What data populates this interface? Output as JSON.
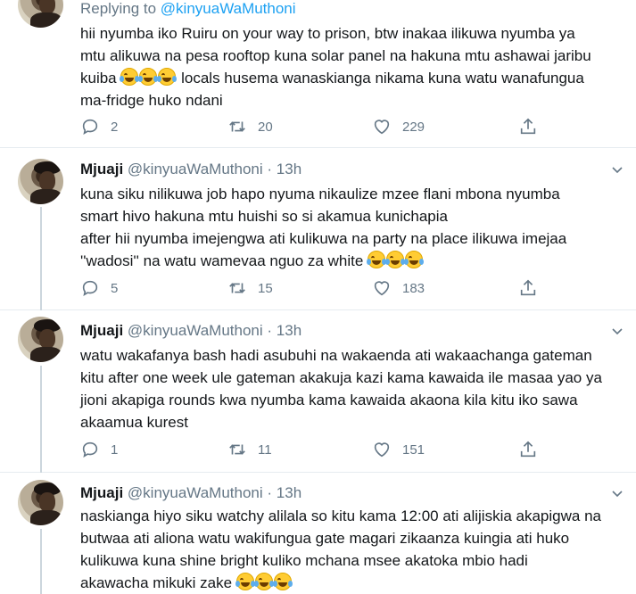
{
  "tweets": [
    {
      "replying_prefix": "Replying to",
      "replying_handle": "@kinyuaWaMuthoni",
      "lines": [
        "hii nyumba iko Ruiru on your way to prison, btw inakaa ilikuwa nyumba ya",
        "mtu alikuwa na pesa rooftop kuna solar panel na hakuna mtu ashawai jaribu",
        "kuiba",
        "ma-fridge huko ndani"
      ],
      "line3_suffix": "locals husema wanaskianga nikama kuna watu wanafungua",
      "reply_count": "2",
      "retweet_count": "20",
      "like_count": "229"
    },
    {
      "name": "Mjuaji",
      "handle": "@kinyuaWaMuthoni",
      "dot": "·",
      "time": "13h",
      "lines": [
        "kuna siku nilikuwa job hapo nyuma nikaulize mzee flani mbona nyumba",
        "smart hivo hakuna mtu huishi so si akamua kunichapia",
        "after hii nyumba imejengwa ati kulikuwa na party na place ilikuwa imejaa",
        "''wadosi'' na watu wamevaa nguo za white"
      ],
      "reply_count": "5",
      "retweet_count": "15",
      "like_count": "183"
    },
    {
      "name": "Mjuaji",
      "handle": "@kinyuaWaMuthoni",
      "dot": "·",
      "time": "13h",
      "lines": [
        "watu wakafanya bash hadi asubuhi na wakaenda ati wakaachanga gateman",
        "kitu after one week ule gateman akakuja kazi kama kawaida ile masaa yao ya",
        "jioni akapiga rounds kwa nyumba kama kawaida akaona kila kitu iko sawa",
        "akaamua kurest"
      ],
      "reply_count": "1",
      "retweet_count": "11",
      "like_count": "151"
    },
    {
      "name": "Mjuaji",
      "handle": "@kinyuaWaMuthoni",
      "dot": "·",
      "time": "13h",
      "lines": [
        "naskianga hiyo siku watchy alilala so kitu kama 12:00 ati alijiskia akapigwa na",
        "butwaa ati aliona watu wakifungua gate magari zikaanza kuingia ati huko",
        "kulikuwa kuna shine bright kuliko mchana msee akatoka mbio hadi",
        "akawacha mikuki zake"
      ]
    }
  ],
  "icons": {
    "reply": "reply-icon",
    "retweet": "retweet-icon",
    "like": "heart-icon",
    "share": "share-icon",
    "emoji": "face-with-tears-of-joy-emoji",
    "caret": "chevron-down-icon"
  },
  "colors": {
    "link": "#1da1f2",
    "muted": "#657786",
    "text": "#14171a",
    "border": "#e6ecf0"
  }
}
